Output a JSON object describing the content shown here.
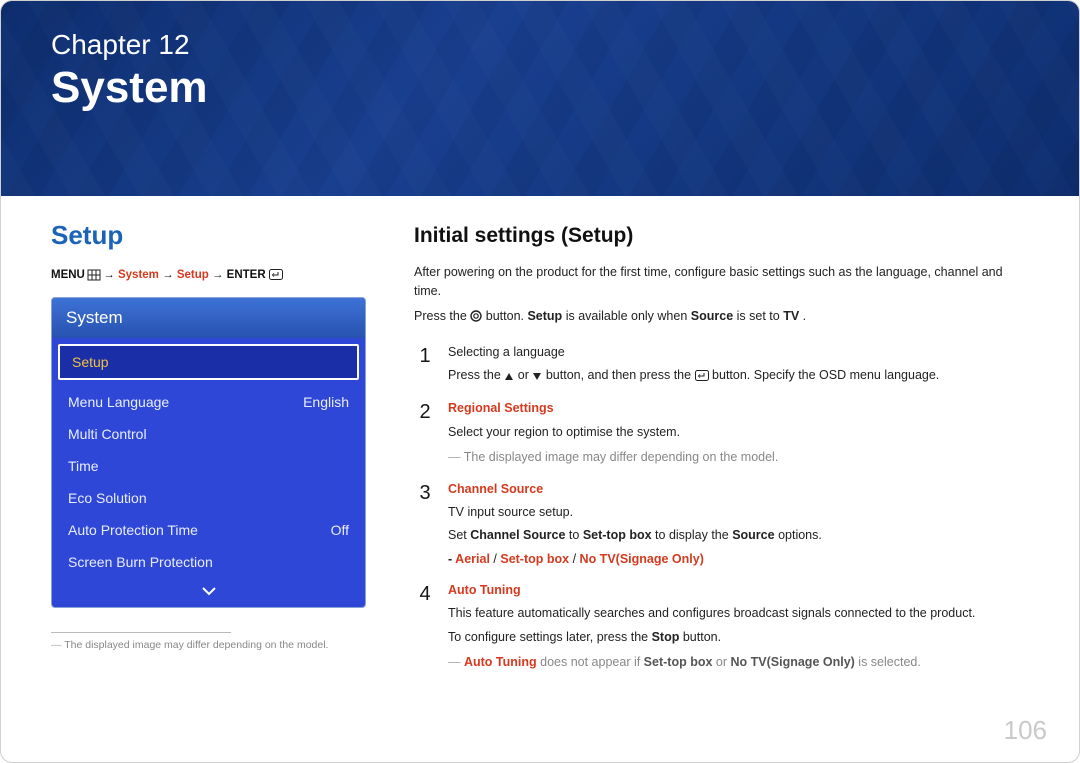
{
  "header": {
    "chapter": "Chapter  12",
    "title": "System"
  },
  "left": {
    "heading": "Setup",
    "crumbs": {
      "menu": "MENU",
      "arrow1": " → ",
      "p1": "System",
      "arrow2": " → ",
      "p2": "Setup",
      "arrow3": " → ",
      "enter": "ENTER"
    },
    "menu": {
      "title": "System",
      "selected": "Setup",
      "rows": [
        {
          "label": "Menu Language",
          "value": "English"
        },
        {
          "label": "Multi Control",
          "value": ""
        },
        {
          "label": "Time",
          "value": ""
        },
        {
          "label": "Eco Solution",
          "value": ""
        },
        {
          "label": "Auto Protection Time",
          "value": "Off"
        },
        {
          "label": "Screen Burn Protection",
          "value": ""
        }
      ],
      "more": "▾"
    },
    "footnote": "The displayed image may differ depending on the model."
  },
  "right": {
    "title": "Initial settings (Setup)",
    "intro": "After powering on the product for the first time, configure basic settings such as the language, channel and time.",
    "note": {
      "pre": "Press the ",
      "post": " button. ",
      "setup": "Setup",
      "mid": " is available only when ",
      "src": "Source",
      "end": " is set to ",
      "tv": "TV",
      "dot": "."
    },
    "s1": {
      "h": "Selecting a language",
      "l1a": "Press the ",
      "l1b": " or ",
      "l1c": " button, and then press the ",
      "l1d": " button. Specify the OSD menu language."
    },
    "s2": {
      "h": "Regional Settings",
      "l1": "Select your region to optimise the system.",
      "tip": "The displayed image may differ depending on the model."
    },
    "s3": {
      "h": "Channel Source",
      "l1": "TV input source setup.",
      "l2a": "Set ",
      "l2b": "Channel Source",
      "l2c": " to ",
      "l2d": "Set-top box",
      "l2e": " to display the ",
      "l2f": "Source",
      "l2g": " options.",
      "opt": {
        "dash": "- ",
        "a": "Aerial",
        "s1": " / ",
        "b": "Set-top box",
        "s2": " / ",
        "c": "No TV(Signage Only)"
      }
    },
    "s4": {
      "h": "Auto Tuning",
      "l1": "This feature automatically searches and configures broadcast signals connected to the product.",
      "l2a": "To configure settings later, press the ",
      "l2b": "Stop",
      "l2c": " button.",
      "tip": {
        "a": "Auto Tuning",
        "b": " does not appear if ",
        "c": "Set-top box",
        "d": " or ",
        "e": "No TV(Signage Only)",
        "f": " is selected."
      }
    }
  },
  "page": "106"
}
